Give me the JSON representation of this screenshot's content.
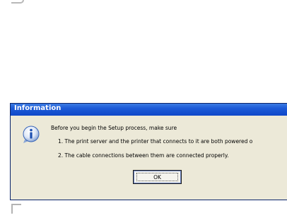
{
  "dialog": {
    "title": "Information",
    "icon": "info-icon",
    "intro": "Before you begin the Setup process, make sure",
    "items": [
      "1. The print server and the printer that connects to it are both powered o",
      "2. The cable connections between them are connected properly."
    ],
    "ok_label": "OK"
  },
  "colors": {
    "titlebar": "#0f47c8",
    "dialog_bg": "#ece9d8"
  }
}
